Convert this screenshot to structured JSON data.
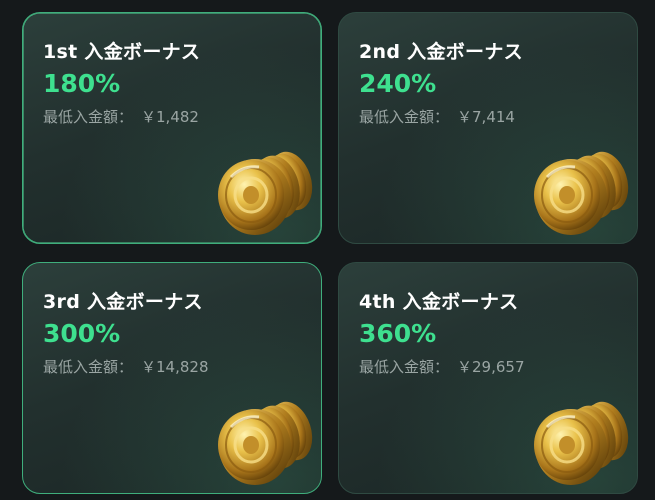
{
  "cards": [
    {
      "title": "1st 入金ボーナス",
      "percent": "180%",
      "deposit_label": "最低入金額：",
      "deposit_amount": "￥1,482",
      "icon": "gold-coins-icon"
    },
    {
      "title": "2nd 入金ボーナス",
      "percent": "240%",
      "deposit_label": "最低入金額：",
      "deposit_amount": "￥7,414",
      "icon": "gold-coins-icon"
    },
    {
      "title": "3rd 入金ボーナス",
      "percent": "300%",
      "deposit_label": "最低入金額：",
      "deposit_amount": "￥14,828",
      "icon": "gold-coins-icon"
    },
    {
      "title": "4th 入金ボーナス",
      "percent": "360%",
      "deposit_label": "最低入金額：",
      "deposit_amount": "￥29,657",
      "icon": "gold-coins-icon"
    }
  ],
  "colors": {
    "accent_green": "#3ee08f",
    "card_bg": "#22302e",
    "page_bg": "#15191b",
    "coin_gold": "#d9a62c"
  }
}
